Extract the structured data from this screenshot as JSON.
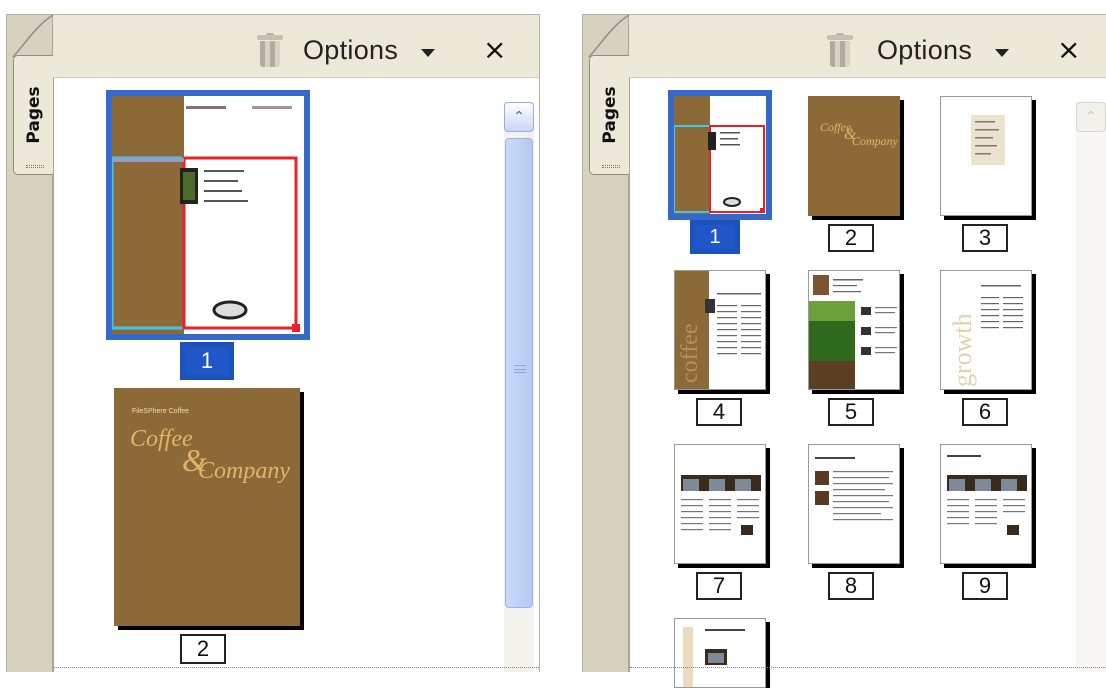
{
  "left_panel": {
    "tab_label": "Pages",
    "options_label": "Options",
    "close_label": "×",
    "scroll_up": "⌃",
    "thumbnails": [
      {
        "page": "1",
        "selected": true
      },
      {
        "page": "2",
        "selected": false
      }
    ],
    "cover": {
      "heading": "FileSPhere Coffee",
      "title_line1": "Coffee",
      "title_line2": "&",
      "title_line3": "Company"
    }
  },
  "right_panel": {
    "tab_label": "Pages",
    "options_label": "Options",
    "close_label": "×",
    "scroll_up": "⌃",
    "thumbnails": [
      {
        "page": "1",
        "selected": true
      },
      {
        "page": "2",
        "selected": false
      },
      {
        "page": "3",
        "selected": false
      },
      {
        "page": "4",
        "selected": false
      },
      {
        "page": "5",
        "selected": false
      },
      {
        "page": "6",
        "selected": false
      },
      {
        "page": "7",
        "selected": false
      },
      {
        "page": "8",
        "selected": false
      },
      {
        "page": "9",
        "selected": false
      }
    ],
    "cover": {
      "title_line1": "Coffee",
      "title_line2": "&",
      "title_line3": "Company"
    },
    "page6_word": "growth",
    "page4_word": "coffee"
  },
  "colors": {
    "brown": "#8c6a38",
    "selection_blue": "#3568c9",
    "cyan_frame": "#3fc6e8",
    "red_frame": "#e8202a",
    "panel_bg": "#ece9d8",
    "cover_gold": "#e0b46a"
  },
  "icons": [
    "trash-icon",
    "caret-down-icon",
    "close-icon",
    "scroll-up-icon",
    "scroll-grip-icon",
    "grip-icon"
  ]
}
